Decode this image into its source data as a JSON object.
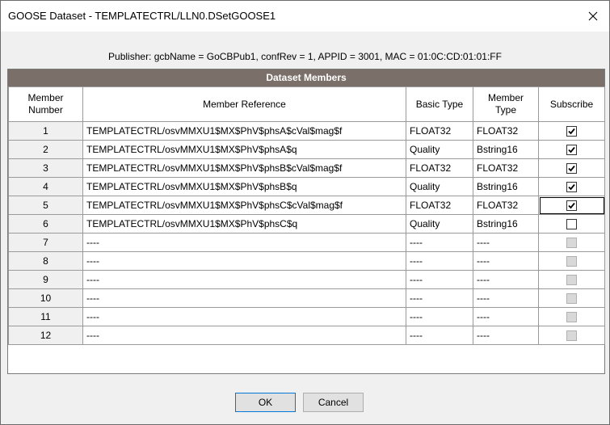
{
  "window": {
    "title": "GOOSE Dataset - TEMPLATECTRL/LLN0.DSetGOOSE1"
  },
  "publisher_info": "Publisher: gcbName = GoCBPub1, confRev = 1, APPID = 3001, MAC = 01:0C:CD:01:01:FF",
  "grid": {
    "title": "Dataset Members",
    "headers": [
      "Member Number",
      "Member Reference",
      "Basic Type",
      "Member Type",
      "Subscribe"
    ],
    "rows": [
      {
        "num": "1",
        "ref": "TEMPLATECTRL/osvMMXU1$MX$PhV$phsA$cVal$mag$f",
        "basic": "FLOAT32",
        "member": "FLOAT32",
        "subscribe": true,
        "enabled": true
      },
      {
        "num": "2",
        "ref": "TEMPLATECTRL/osvMMXU1$MX$PhV$phsA$q",
        "basic": "Quality",
        "member": "Bstring16",
        "subscribe": true,
        "enabled": true
      },
      {
        "num": "3",
        "ref": "TEMPLATECTRL/osvMMXU1$MX$PhV$phsB$cVal$mag$f",
        "basic": "FLOAT32",
        "member": "FLOAT32",
        "subscribe": true,
        "enabled": true
      },
      {
        "num": "4",
        "ref": "TEMPLATECTRL/osvMMXU1$MX$PhV$phsB$q",
        "basic": "Quality",
        "member": "Bstring16",
        "subscribe": true,
        "enabled": true
      },
      {
        "num": "5",
        "ref": "TEMPLATECTRL/osvMMXU1$MX$PhV$phsC$cVal$mag$f",
        "basic": "FLOAT32",
        "member": "FLOAT32",
        "subscribe": true,
        "enabled": true
      },
      {
        "num": "6",
        "ref": "TEMPLATECTRL/osvMMXU1$MX$PhV$phsC$q",
        "basic": "Quality",
        "member": "Bstring16",
        "subscribe": false,
        "enabled": true
      },
      {
        "num": "7",
        "ref": "----",
        "basic": "----",
        "member": "----",
        "subscribe": false,
        "enabled": false
      },
      {
        "num": "8",
        "ref": "----",
        "basic": "----",
        "member": "----",
        "subscribe": false,
        "enabled": false
      },
      {
        "num": "9",
        "ref": "----",
        "basic": "----",
        "member": "----",
        "subscribe": false,
        "enabled": false
      },
      {
        "num": "10",
        "ref": "----",
        "basic": "----",
        "member": "----",
        "subscribe": false,
        "enabled": false
      },
      {
        "num": "11",
        "ref": "----",
        "basic": "----",
        "member": "----",
        "subscribe": false,
        "enabled": false
      },
      {
        "num": "12",
        "ref": "----",
        "basic": "----",
        "member": "----",
        "subscribe": false,
        "enabled": false
      }
    ]
  },
  "buttons": {
    "ok": "OK",
    "cancel": "Cancel"
  },
  "icons": {
    "close": "close-icon",
    "check": "check-icon"
  },
  "colors": {
    "grid_header_bg": "#7a6f69",
    "ok_border": "#0078d7"
  }
}
